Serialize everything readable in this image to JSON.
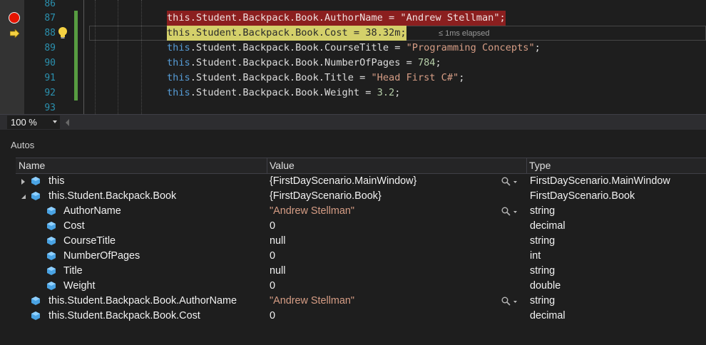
{
  "editor": {
    "line_numbers": [
      "86",
      "87",
      "88",
      "89",
      "90",
      "91",
      "92",
      "93"
    ],
    "lines": [
      {
        "kw": "this",
        "rest": ".Student.Backpack.Book.AuthorName = ",
        "val": "\"Andrew Stellman\"",
        "val_type": "str",
        "end": ";"
      },
      {
        "kw": "this",
        "rest": ".Student.Backpack.Book.Cost = ",
        "val": "38.32m",
        "val_type": "num",
        "end": ";"
      },
      {
        "kw": "this",
        "rest": ".Student.Backpack.Book.CourseTitle = ",
        "val": "\"Programming Concepts\"",
        "val_type": "str",
        "end": ";"
      },
      {
        "kw": "this",
        "rest": ".Student.Backpack.Book.NumberOfPages = ",
        "val": "784",
        "val_type": "num",
        "end": ";"
      },
      {
        "kw": "this",
        "rest": ".Student.Backpack.Book.Title = ",
        "val": "\"Head First C#\"",
        "val_type": "str",
        "end": ";"
      },
      {
        "kw": "this",
        "rest": ".Student.Backpack.Book.Weight = ",
        "val": "3.2",
        "val_type": "num",
        "end": ";"
      }
    ],
    "elapsed_hint": "≤ 1ms elapsed",
    "icons": {
      "breakpoint": "breakpoint-icon",
      "current_statement": "current-statement-arrow-icon",
      "quick_action": "lightbulb-icon"
    },
    "colors": {
      "breakpoint_highlight": "#8b1f1f",
      "current_highlight": "#d4d06a",
      "keyword": "#569cd6",
      "string": "#d69d85"
    }
  },
  "zoom": {
    "value": "100 %"
  },
  "autos": {
    "title": "Autos",
    "columns": {
      "name": "Name",
      "value": "Value",
      "type": "Type"
    },
    "rows": [
      {
        "name": "this",
        "value": "{FirstDayScenario.MainWindow}",
        "type": "FirstDayScenario.MainWindow"
      },
      {
        "name": "this.Student.Backpack.Book",
        "value": "{FirstDayScenario.Book}",
        "type": "FirstDayScenario.Book"
      },
      {
        "name": "AuthorName",
        "value": "\"Andrew Stellman\"",
        "type": "string"
      },
      {
        "name": "Cost",
        "value": "0",
        "type": "decimal"
      },
      {
        "name": "CourseTitle",
        "value": "null",
        "type": "string"
      },
      {
        "name": "NumberOfPages",
        "value": "0",
        "type": "int"
      },
      {
        "name": "Title",
        "value": "null",
        "type": "string"
      },
      {
        "name": "Weight",
        "value": "0",
        "type": "double"
      },
      {
        "name": "this.Student.Backpack.Book.AuthorName",
        "value": "\"Andrew Stellman\"",
        "type": "string"
      },
      {
        "name": "this.Student.Backpack.Book.Cost",
        "value": "0",
        "type": "decimal"
      }
    ]
  }
}
